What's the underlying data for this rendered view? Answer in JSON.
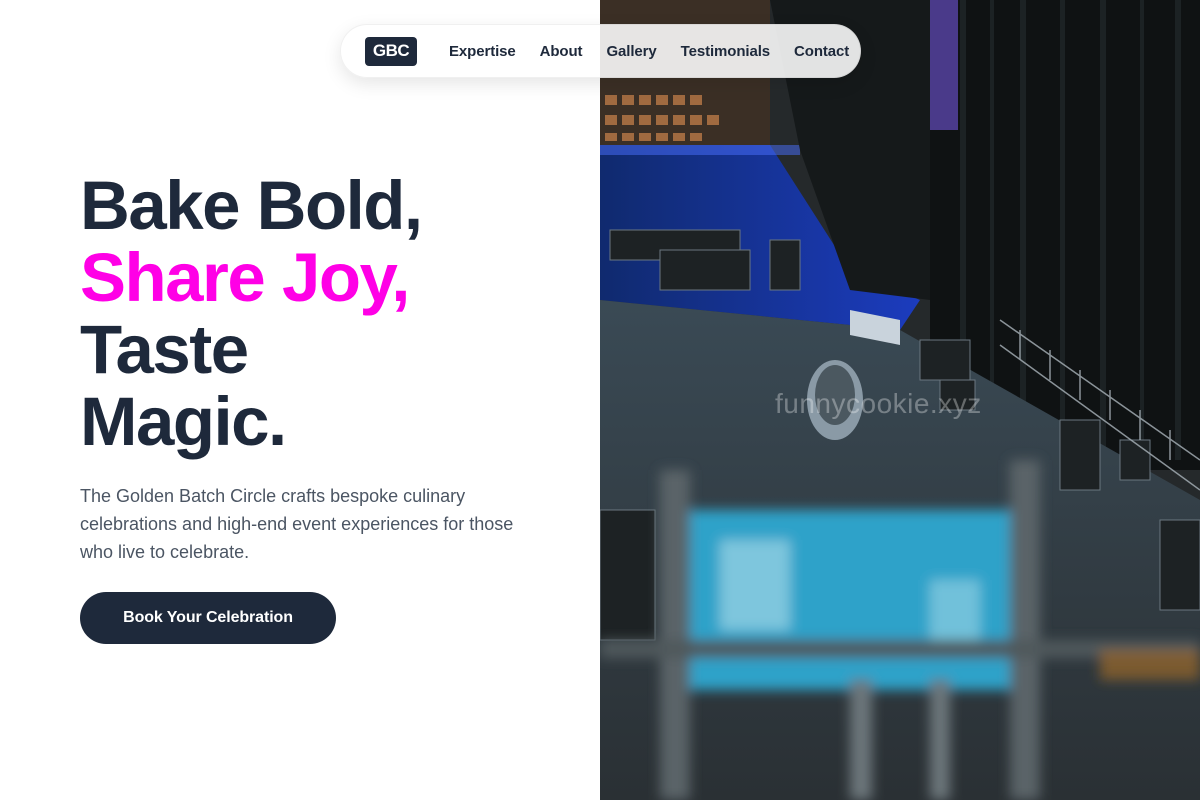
{
  "nav": {
    "logo": "GBC",
    "links": [
      "Expertise",
      "About",
      "Gallery",
      "Testimonials",
      "Contact"
    ]
  },
  "hero": {
    "headline": [
      "Bake Bold,",
      "Share Joy,",
      "Taste",
      "Magic."
    ],
    "accent_color": "#ff00e6",
    "text_color": "#1e293b",
    "description": "The Golden Batch Circle crafts bespoke culinary celebrations and high-end event experiences for those who live to celebrate.",
    "cta_label": "Book Your Celebration"
  },
  "image": {
    "watermark": "funnycookie.xyz",
    "subject": "arena-event-setup-photo"
  }
}
